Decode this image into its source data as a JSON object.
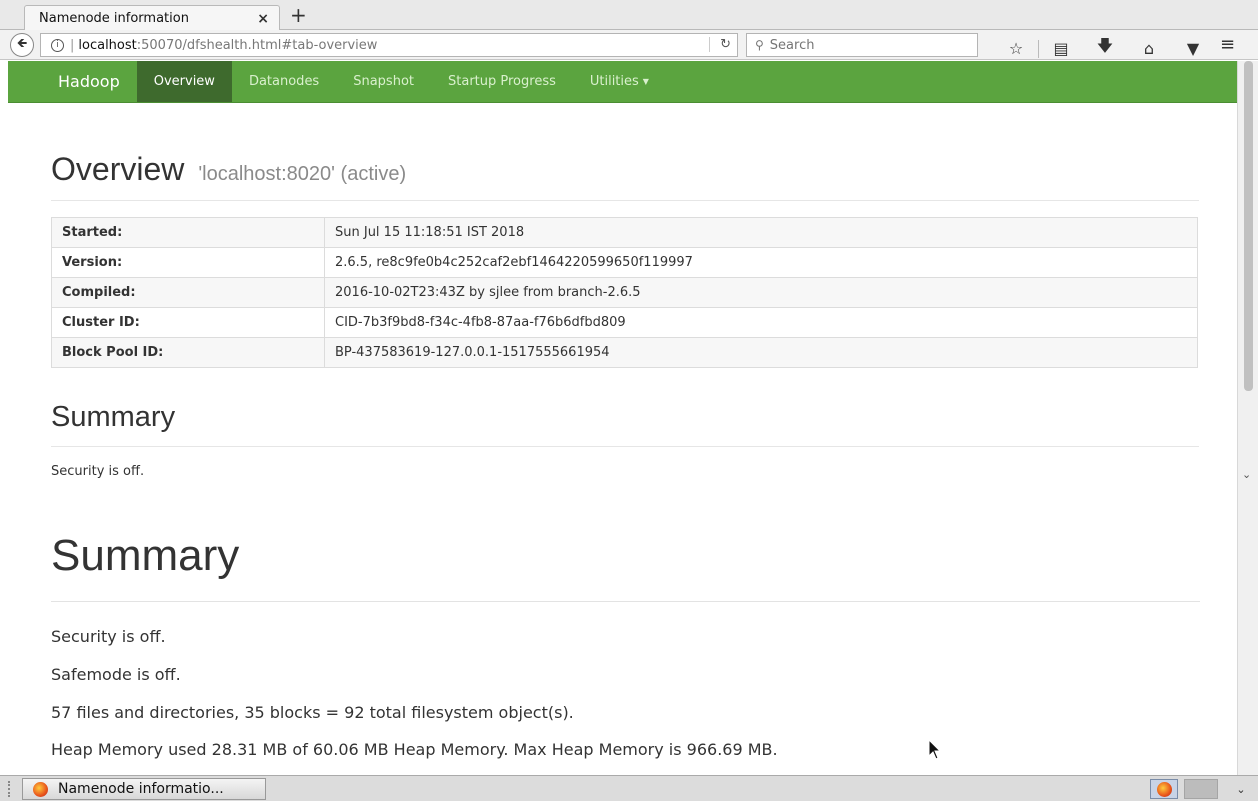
{
  "browser": {
    "tab_title": "Namenode information",
    "tab_close": "×",
    "new_tab": "+",
    "url_host": "localhost",
    "url_path": ":50070/dfshealth.html#tab-overview",
    "url_separator": "|",
    "search_placeholder": "Search"
  },
  "icons": {
    "back": "back-arrow-icon",
    "info": "info-icon",
    "reload": "reload-icon",
    "search": "search-icon",
    "bookmark": "star-icon",
    "reading_list": "reading-list-icon",
    "download": "download-icon",
    "home": "home-icon",
    "pocket": "pocket-icon",
    "menu": "hamburger-menu-icon"
  },
  "nav": {
    "brand": "Hadoop",
    "items": [
      {
        "label": "Overview",
        "active": true
      },
      {
        "label": "Datanodes",
        "active": false
      },
      {
        "label": "Snapshot",
        "active": false
      },
      {
        "label": "Startup Progress",
        "active": false
      },
      {
        "label": "Utilities",
        "active": false
      }
    ],
    "active_bg": "#3e6a2d",
    "bar_color": "#5ba43f"
  },
  "overview": {
    "title": "Overview",
    "subtitle": "'localhost:8020' (active)",
    "rows": [
      {
        "key": "Started:",
        "value": "Sun Jul 15 11:18:51 IST 2018"
      },
      {
        "key": "Version:",
        "value": "2.6.5, re8c9fe0b4c252caf2ebf1464220599650f119997"
      },
      {
        "key": "Compiled:",
        "value": "2016-10-02T23:43Z by sjlee from branch-2.6.5"
      },
      {
        "key": "Cluster ID:",
        "value": "CID-7b3f9bd8-f34c-4fb8-87aa-f76b6dfbd809"
      },
      {
        "key": "Block Pool ID:",
        "value": "BP-437583619-127.0.0.1-1517555661954"
      }
    ]
  },
  "summary": {
    "title": "Summary",
    "lines": [
      "Security is off.",
      "Safemode is off.",
      "57 files and directories, 35 blocks = 92 total filesystem object(s).",
      "Heap Memory used 28.31 MB of 60.06 MB Heap Memory. Max Heap Memory is 966.69 MB."
    ]
  },
  "taskbar": {
    "window_label": "Namenode informatio..."
  }
}
